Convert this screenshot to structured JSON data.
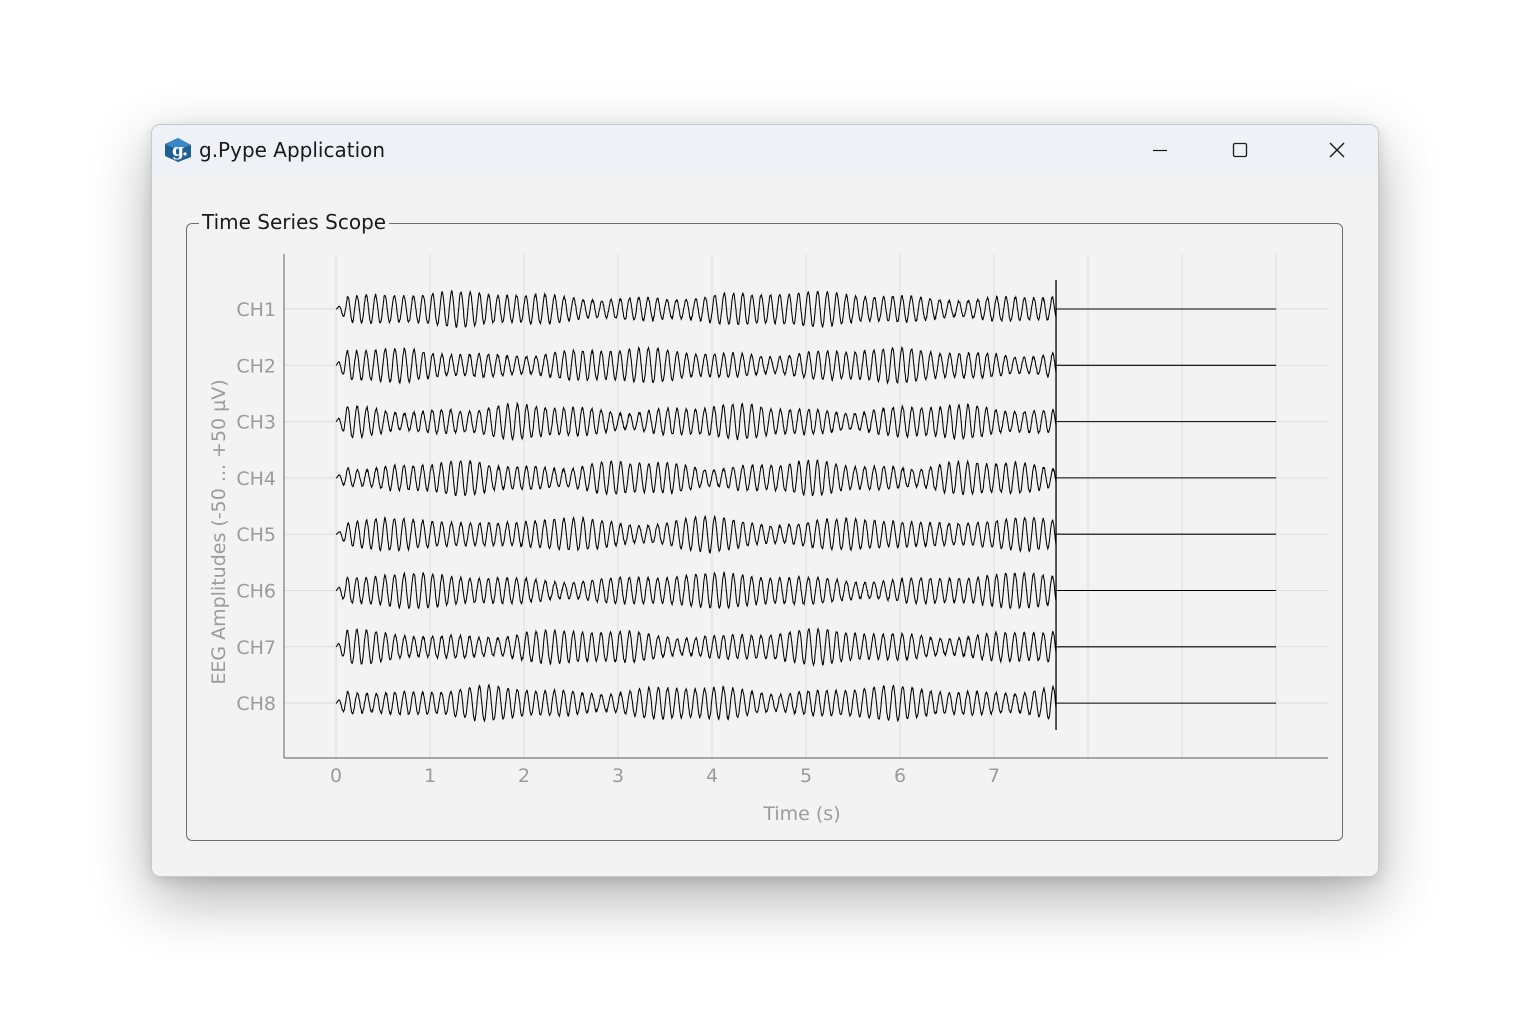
{
  "window": {
    "title": "g.Pype Application",
    "icon": "g-logo-icon",
    "controls": {
      "minimize": "minimize-icon",
      "maximize": "maximize-icon",
      "close": "close-icon"
    }
  },
  "group": {
    "title": "Time Series Scope"
  },
  "chart_data": {
    "type": "line",
    "title": "",
    "xlabel": "Time (s)",
    "ylabel": "EEG Amplitudes (-50 ... +50 µV)",
    "xlim": [
      -0.55,
      10.55
    ],
    "x_ticks": [
      0,
      1,
      2,
      3,
      4,
      5,
      6,
      7
    ],
    "grid_x": [
      0,
      1,
      2,
      3,
      4,
      5,
      6,
      7,
      8,
      9,
      10
    ],
    "channels": [
      "CH1",
      "CH2",
      "CH3",
      "CH4",
      "CH5",
      "CH6",
      "CH7",
      "CH8"
    ],
    "channel_range_uV": [
      -50,
      50
    ],
    "signal": {
      "description_frequency_hz": 10,
      "recorded_until_s": 7.66,
      "flat_until_s": 10,
      "approx_amplitude_uV": 40
    },
    "grid": true,
    "colors": {
      "trace": "#000000",
      "grid": "#dedede",
      "axis_text": "#9b9b9b"
    }
  }
}
